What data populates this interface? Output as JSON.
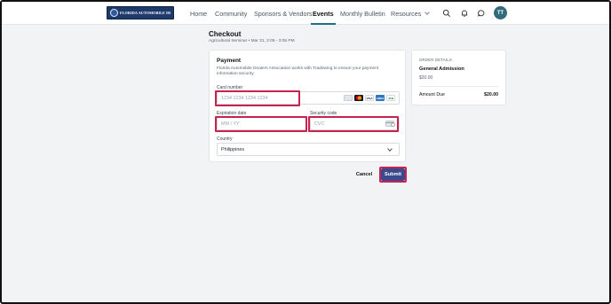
{
  "nav": {
    "logo_text": "FLORIDA AUTOMOBILE DEALERS ASSOCIATION",
    "items": [
      "Home",
      "Community",
      "Sponsors & Vendors",
      "Events",
      "Monthly Bulletin",
      "Resources"
    ],
    "active": "Events",
    "avatar_initials": "TT"
  },
  "checkout": {
    "title": "Checkout",
    "event": "Agricultural Seminar",
    "date": "Mar 31, 2:05 - 3:05 PM"
  },
  "payment": {
    "title": "Payment",
    "description": "Florida Automobile Dealers Association works with Tradewing to ensure your payment information security.",
    "card_number_label": "Card number",
    "card_number_placeholder": "1234 1234 1234 1234",
    "expiration_label": "Expiration date",
    "expiration_placeholder": "MM / YY",
    "security_label": "Security code",
    "security_placeholder": "CVC",
    "country_label": "Country",
    "country_value": "Philippines",
    "brands": [
      "generic-card-icon",
      "mastercard-icon",
      "visa-icon",
      "amex-icon",
      "jcb-icon"
    ],
    "brand_labels": {
      "visa": "VISA",
      "amex": "AMEX",
      "jcb": "JCB"
    }
  },
  "order": {
    "heading": "ORDER DETAILS",
    "item": "General Admission",
    "price": "$20.00",
    "amount_due_label": "Amount Due",
    "amount_due_value": "$20.00"
  },
  "actions": {
    "cancel": "Cancel",
    "submit": "Submit"
  },
  "colors": {
    "highlight": "#c8234f",
    "submit": "#3b4a8c",
    "brand_navy": "#1e3a6b",
    "avatar": "#2f6b7c"
  }
}
